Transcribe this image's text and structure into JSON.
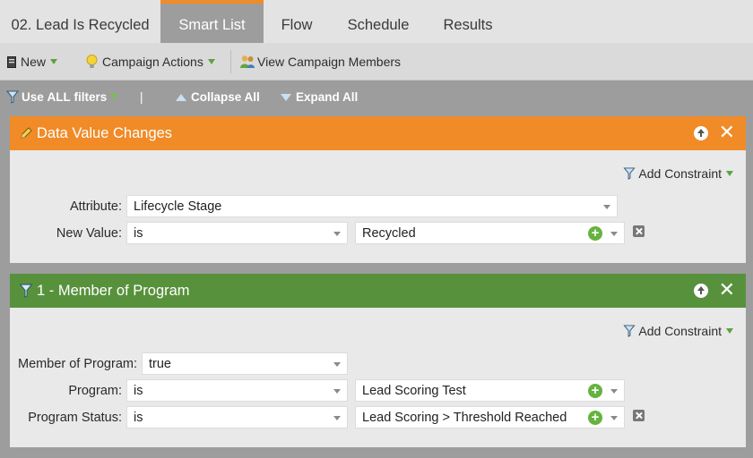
{
  "tabs": [
    {
      "label": "02. Lead Is Recycled",
      "active": false
    },
    {
      "label": "Smart List",
      "active": true
    },
    {
      "label": "Flow",
      "active": false
    },
    {
      "label": "Schedule",
      "active": false
    },
    {
      "label": "Results",
      "active": false
    }
  ],
  "toolbar": {
    "new_label": "New",
    "campaign_actions_label": "Campaign Actions",
    "view_members_label": "View Campaign Members"
  },
  "filterbar": {
    "use_all_prefix": "Use ",
    "use_all_bold": "ALL",
    "use_all_suffix": " filters",
    "divider": "|",
    "collapse_all": "Collapse All",
    "expand_all": "Expand All"
  },
  "filters": [
    {
      "title": "Data Value Changes",
      "header_color": "#f08b27",
      "add_constraint": "Add Constraint",
      "rows": [
        {
          "label": "Attribute:",
          "value": "Lifecycle Stage"
        },
        {
          "label": "New Value:",
          "operator": "is",
          "value": "Recycled"
        }
      ]
    },
    {
      "title": "1 - Member of Program",
      "header_color": "#58913c",
      "add_constraint": "Add Constraint",
      "rows": [
        {
          "label": "Member of Program:",
          "value": "true"
        },
        {
          "label": "Program:",
          "operator": "is",
          "value": "Lead Scoring Test"
        },
        {
          "label": "Program Status:",
          "operator": "is",
          "value": "Lead Scoring > Threshold Reached"
        }
      ]
    }
  ],
  "colors": {
    "accent_orange": "#f08b27",
    "member_green": "#58913c",
    "plus_green": "#64b33f"
  },
  "icons": [
    "new-document-icon",
    "lightbulb-icon",
    "people-icon",
    "filter-icon",
    "collapse-icon",
    "expand-icon",
    "pencil-icon",
    "move-up-icon",
    "close-icon",
    "add-value-icon",
    "delete-icon"
  ]
}
